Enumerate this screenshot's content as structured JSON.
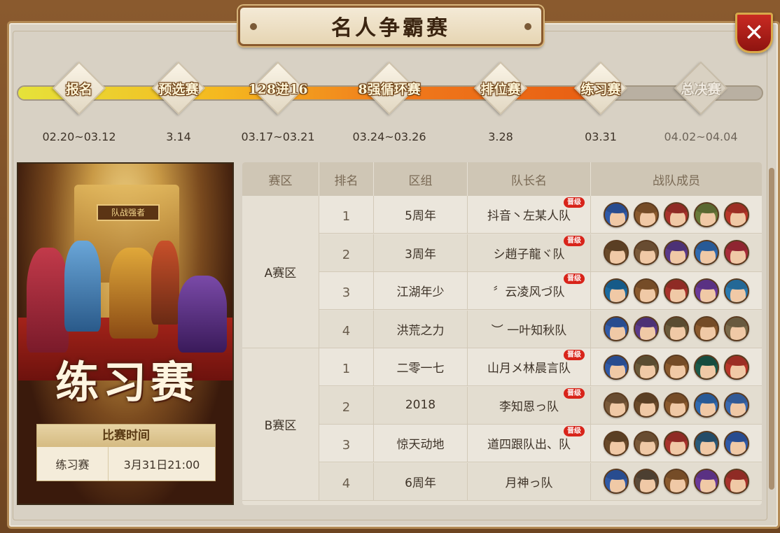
{
  "title": "名人争霸赛",
  "close_label": "✕",
  "progress": {
    "fill_fraction": 0.78
  },
  "stages": [
    {
      "label": "报名",
      "date": "02.20~03.12",
      "active": true
    },
    {
      "label": "预选赛",
      "date": "3.14",
      "active": true
    },
    {
      "label": "128进16",
      "date": "03.17~03.21",
      "active": true
    },
    {
      "label": "8强循环赛",
      "date": "03.24~03.26",
      "active": true
    },
    {
      "label": "排位赛",
      "date": "3.28",
      "active": true
    },
    {
      "label": "练习赛",
      "date": "03.31",
      "active": true
    },
    {
      "label": "总决赛",
      "date": "04.02~04.04",
      "active": false
    }
  ],
  "poster": {
    "sign": "队战强者",
    "title": "练习赛",
    "time_header": "比赛时间",
    "time_type": "练习赛",
    "time_value": "3月31日21:00"
  },
  "table": {
    "headers": {
      "zone": "赛区",
      "rank": "排名",
      "group": "区组",
      "captain": "队长名",
      "members": "战队成员"
    },
    "zones": [
      {
        "name": "A赛区",
        "rows": [
          {
            "rank": "1",
            "group": "5周年",
            "captain": "抖音丶左某人队",
            "badge": "晋级",
            "avatars": [
              "#2f5aa8",
              "#8a5a2e",
              "#a8322c",
              "#6a7a3a",
              "#b8362a"
            ]
          },
          {
            "rank": "2",
            "group": "3周年",
            "captain": "シ趙子龍ヾ队",
            "badge": "晋级",
            "avatars": [
              "#6a4a2a",
              "#7a5a3a",
              "#5a3a8a",
              "#2f6ab0",
              "#a82c3a"
            ]
          },
          {
            "rank": "3",
            "group": "江湖年少",
            "captain": "〞云凌风づ队",
            "badge": "晋级",
            "avatars": [
              "#1a6aa0",
              "#8a5a2e",
              "#a8322c",
              "#6a3a9a",
              "#2a7ab0"
            ]
          },
          {
            "rank": "4",
            "group": "洪荒之力",
            "captain": "︶ 一叶知秋队",
            "badge": "",
            "avatars": [
              "#2f5aa8",
              "#5a3a8a",
              "#6a5a3a",
              "#8a5a2e",
              "#7a6a4a"
            ]
          }
        ]
      },
      {
        "name": "B赛区",
        "rows": [
          {
            "rank": "1",
            "group": "二零一七",
            "captain": "山月メ林晨言队",
            "badge": "晋级",
            "avatars": [
              "#2f5aa8",
              "#6a5a3a",
              "#8a5a2e",
              "#1a5a4a",
              "#b8362a"
            ]
          },
          {
            "rank": "2",
            "group": "2018",
            "captain": "李知恩っ队",
            "badge": "晋级",
            "avatars": [
              "#7a5a3a",
              "#6a4a2a",
              "#8a5a2e",
              "#2f6ab0",
              "#3a6ab0"
            ]
          },
          {
            "rank": "3",
            "group": "惊天动地",
            "captain": "道四跟队出、队",
            "badge": "晋级",
            "avatars": [
              "#6a4a2a",
              "#7a5a3a",
              "#a8322c",
              "#2a5a7a",
              "#2f5aa8"
            ]
          },
          {
            "rank": "4",
            "group": "6周年",
            "captain": "月神っ队",
            "badge": "",
            "avatars": [
              "#2f5aa8",
              "#5a4a3a",
              "#8a5a2e",
              "#6a3a9a",
              "#a8322c"
            ]
          }
        ]
      }
    ]
  }
}
